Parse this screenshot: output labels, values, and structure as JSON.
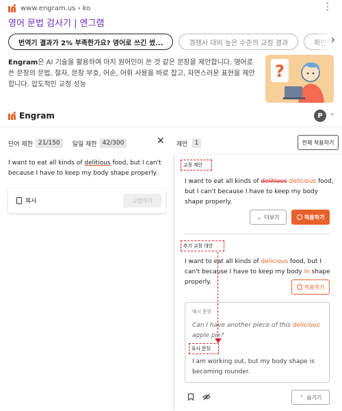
{
  "search_result": {
    "url": "www.engram.us › ko",
    "title": "영어 문법 검사기 | 엔그램",
    "chips": [
      "번역기 결과가 2% 부족한가요? 영어로 쓰긴 썼...",
      "경쟁사 대비 높은 수준의 교정 결과",
      "확인하"
    ],
    "description_brand": "Engram",
    "description": "은 AI 기술을 활용하여 마치 원어민이 쓴 것 같은 문장을 제안합니다. 영어로 쓴 문장의 문법, 철자, 문장 부호, 어순, 어휘 사용을 바로 잡고, 자연스러운 표현을 제안합니다. 압도적인 교정 성능"
  },
  "app_header": {
    "brand": "Engram",
    "avatar_letter": "P"
  },
  "left_panel": {
    "word_limit_label": "단어 제한",
    "word_limit_value": "21/150",
    "daily_limit_label": "일일 제한",
    "daily_limit_value": "42/300",
    "input_text_before": "I want to eat all kinds of ",
    "input_error_word": "delitious",
    "input_text_after": " food, but I can't because I have to keep my body shape properly.",
    "copy_label": "복사",
    "check_label": "교정하기"
  },
  "right_panel": {
    "suggestions_label": "제안",
    "suggestions_count": "1",
    "apply_all_label": "전체 적용하기",
    "correction_tag": "교정 제안",
    "correction": {
      "before": "I want to eat all kinds of ",
      "struck": "delitious",
      "fixed": "delicious",
      "after": " food, but I can't because I have to keep my body shape properly."
    },
    "more_label": "더보기",
    "apply_label": "적용하기",
    "alt_tag": "추가 교정 대안",
    "alt": {
      "before": "I want to eat all kinds of ",
      "fixed": "delicious",
      "mid": " food, but I can't because I have to keep my body ",
      "inserted": "in",
      "after": " shape properly."
    },
    "alt_apply_label": "적용하기",
    "example_label": "예시 문장",
    "example": {
      "before": "Can I have another piece of this ",
      "word": "delicious",
      "after": " apple pie?"
    },
    "similar_tag": "유사 문장",
    "similar_text": "I am working out, but my body shape is becoming rounder.",
    "hide_label": "숨기기"
  },
  "colors": {
    "accent": "#e8612c",
    "title_link": "#6b2fb8",
    "annotation": "#d9222a"
  }
}
